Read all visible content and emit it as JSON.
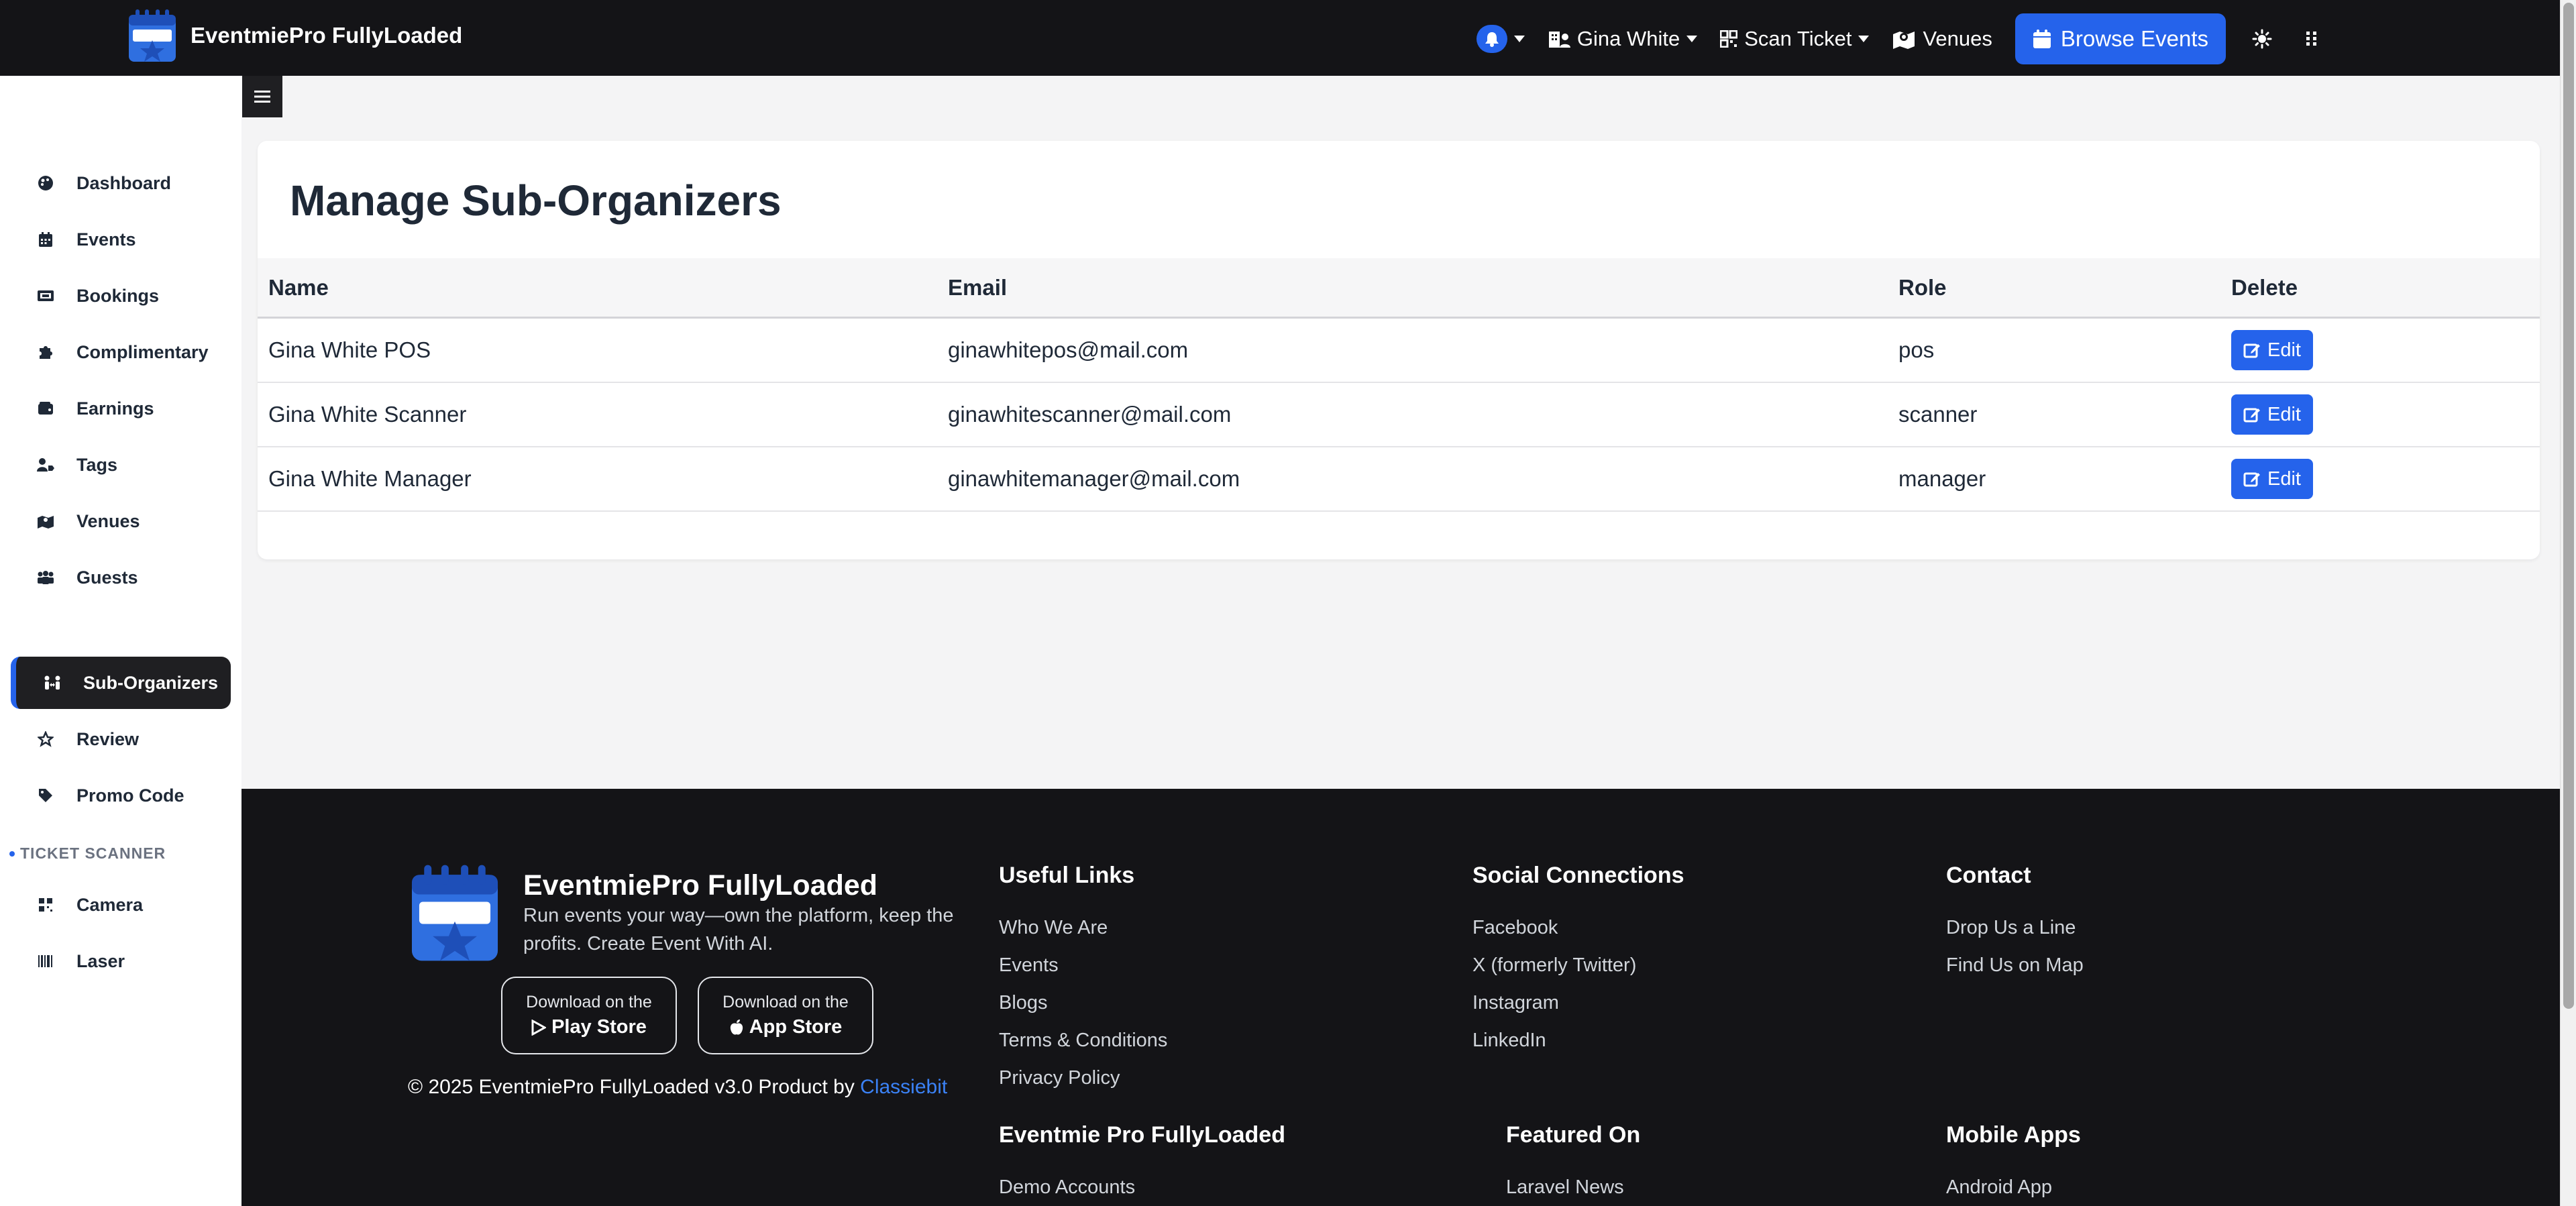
{
  "app": {
    "brand_name": "EventmiePro FullyLoaded"
  },
  "nav": {
    "user_label": "Gina White",
    "scan_label": "Scan Ticket",
    "venues_label": "Venues",
    "browse_label": "Browse Events"
  },
  "sidebar": {
    "items": [
      {
        "label": "Dashboard",
        "icon": "palette-icon"
      },
      {
        "label": "Events",
        "icon": "calendar-icon"
      },
      {
        "label": "Bookings",
        "icon": "ticket-icon"
      },
      {
        "label": "Complimentary",
        "icon": "puzzle-icon"
      },
      {
        "label": "Earnings",
        "icon": "wallet-icon"
      },
      {
        "label": "Tags",
        "icon": "user-tag-icon"
      },
      {
        "label": "Venues",
        "icon": "map-location-icon"
      },
      {
        "label": "Guests",
        "icon": "people-group-icon"
      },
      {
        "label": "Sub-Organizers",
        "icon": "people-arrows-icon"
      },
      {
        "label": "Review",
        "icon": "star-icon"
      },
      {
        "label": "Promo Code",
        "icon": "tag-icon"
      }
    ],
    "scanner_heading": "TICKET SCANNER",
    "scanner_items": [
      {
        "label": "Camera",
        "icon": "qrcode-icon"
      },
      {
        "label": "Laser",
        "icon": "barcode-icon"
      }
    ]
  },
  "main": {
    "title": "Manage Sub-Organizers",
    "columns": [
      "Name",
      "Email",
      "Role",
      "Delete"
    ],
    "rows": [
      {
        "name": "Gina White POS",
        "email": "ginawhitepos@mail.com",
        "role": "pos",
        "action": "Edit"
      },
      {
        "name": "Gina White Scanner",
        "email": "ginawhitescanner@mail.com",
        "role": "scanner",
        "action": "Edit"
      },
      {
        "name": "Gina White Manager",
        "email": "ginawhitemanager@mail.com",
        "role": "manager",
        "action": "Edit"
      }
    ]
  },
  "footer": {
    "brand_name": "EventmiePro FullyLoaded",
    "tagline": "Run events your way—own the platform, keep the profits. Create Event With AI.",
    "play_small": "Download on the",
    "play_big": "Play Store",
    "app_small": "Download on the",
    "app_big": "App Store",
    "copyright": "© 2025 EventmiePro FullyLoaded v3.0 Product by",
    "copyright_link": "Classiebit",
    "useful": {
      "title": "Useful Links",
      "links": [
        "Who We Are",
        "Events",
        "Blogs",
        "Terms & Conditions",
        "Privacy Policy"
      ]
    },
    "social": {
      "title": "Social Connections",
      "links": [
        "Facebook",
        "X (formerly Twitter)",
        "Instagram",
        "LinkedIn"
      ]
    },
    "contact": {
      "title": "Contact",
      "links": [
        "Drop Us a Line",
        "Find Us on Map"
      ]
    },
    "eventmie": {
      "title": "Eventmie Pro FullyLoaded",
      "links": [
        "Demo Accounts"
      ]
    },
    "featured": {
      "title": "Featured On",
      "links": [
        "Laravel News"
      ]
    },
    "mobile": {
      "title": "Mobile Apps",
      "links": [
        "Android App"
      ]
    }
  },
  "colors": {
    "accent": "#2563eb",
    "dark": "#141417",
    "sidebar_active": "#1f1f22"
  }
}
